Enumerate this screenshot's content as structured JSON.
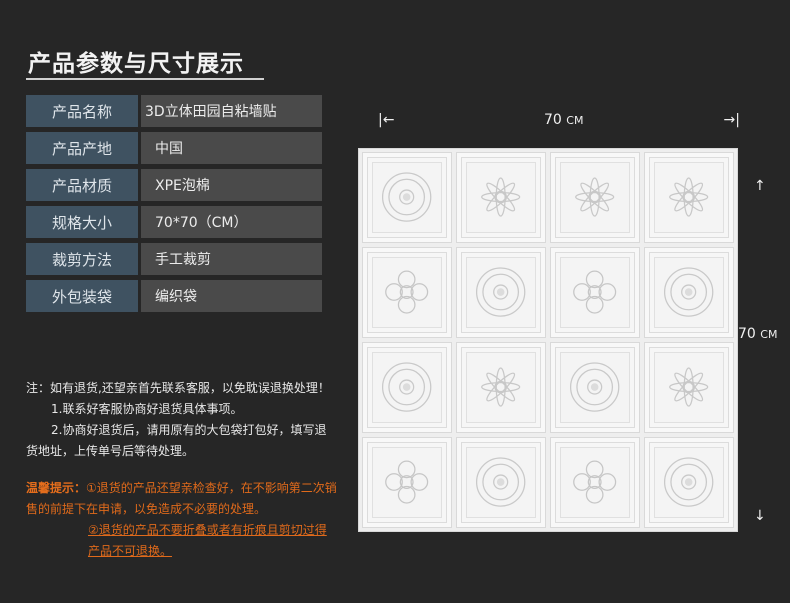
{
  "title": "产品参数与尺寸展示",
  "specs": [
    {
      "label": "产品名称",
      "value": "3D立体田园自粘墙贴"
    },
    {
      "label": "产品产地",
      "value": "中国"
    },
    {
      "label": "产品材质",
      "value": "XPE泡棉"
    },
    {
      "label": "规格大小",
      "value": "70*70（CM）"
    },
    {
      "label": "裁剪方法",
      "value": "手工裁剪"
    },
    {
      "label": "外包装袋",
      "value": "编织袋"
    }
  ],
  "dimensions": {
    "width_value": "70",
    "height_value": "70",
    "unit": "CM",
    "left_tick": "|←",
    "right_tick": "→|",
    "up_arrow": "↑",
    "down_arrow": "↓"
  },
  "notes": {
    "line1": "注：如有退货,还望亲首先联系客服，以免耽误退换处理！",
    "line2": "1.联系好客服协商好退货具体事项。",
    "line3": "2.协商好退货后，请用原有的大包袋打包好，填写退",
    "line4": "货地址，上传单号后等待处理。"
  },
  "warm_tips": {
    "head": "温馨提示：",
    "tip1": "①退货的产品还望亲检查好，在不影响第二次销售的前提下在申请，以免造成不必要的处理。",
    "tip2": "②退货的产品不要折叠或者有折痕且剪切过得产品不可退换。"
  },
  "colors": {
    "background": "#262626",
    "label_bg": "#3f5261",
    "value_bg": "#4a4a4a",
    "warning": "#e06a1b"
  }
}
